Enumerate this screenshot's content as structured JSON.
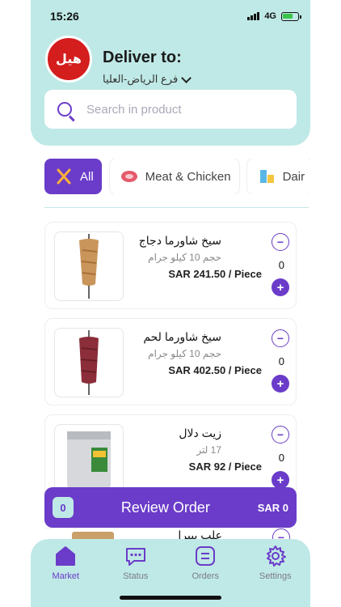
{
  "status_bar": {
    "time": "15:26",
    "network": "4G"
  },
  "header": {
    "logo_text": "هيل",
    "deliver_to": "Deliver to:",
    "branch": "فرع الرياض-العليا",
    "search_placeholder": "Search in product"
  },
  "categories": [
    {
      "label": "All",
      "icon": "fork-knife-icon",
      "active": true
    },
    {
      "label": "Meat & Chicken",
      "icon": "meat-icon",
      "active": false
    },
    {
      "label": "Dair",
      "icon": "dairy-icon",
      "active": false
    }
  ],
  "products": [
    {
      "name": "سيخ شاورما دجاج",
      "size": "حجم 10 كيلو جرام",
      "price": "SAR 241.50 / Piece",
      "qty": "0"
    },
    {
      "name": "سيخ شاورما لحم",
      "size": "حجم 10 كيلو جرام",
      "price": "SAR 402.50 / Piece",
      "qty": "0"
    },
    {
      "name": "زيت دلال",
      "size": "17 لتر",
      "price": "SAR 92 / Piece",
      "qty": "0"
    },
    {
      "name": "علب بيبرا"
    }
  ],
  "review": {
    "count": "0",
    "label": "Review Order",
    "total": "SAR 0"
  },
  "nav": [
    {
      "label": "Market"
    },
    {
      "label": "Status"
    },
    {
      "label": "Orders"
    },
    {
      "label": "Settings"
    }
  ],
  "colors": {
    "accent": "#6a3cc9",
    "header_bg": "#bfe9e6"
  }
}
